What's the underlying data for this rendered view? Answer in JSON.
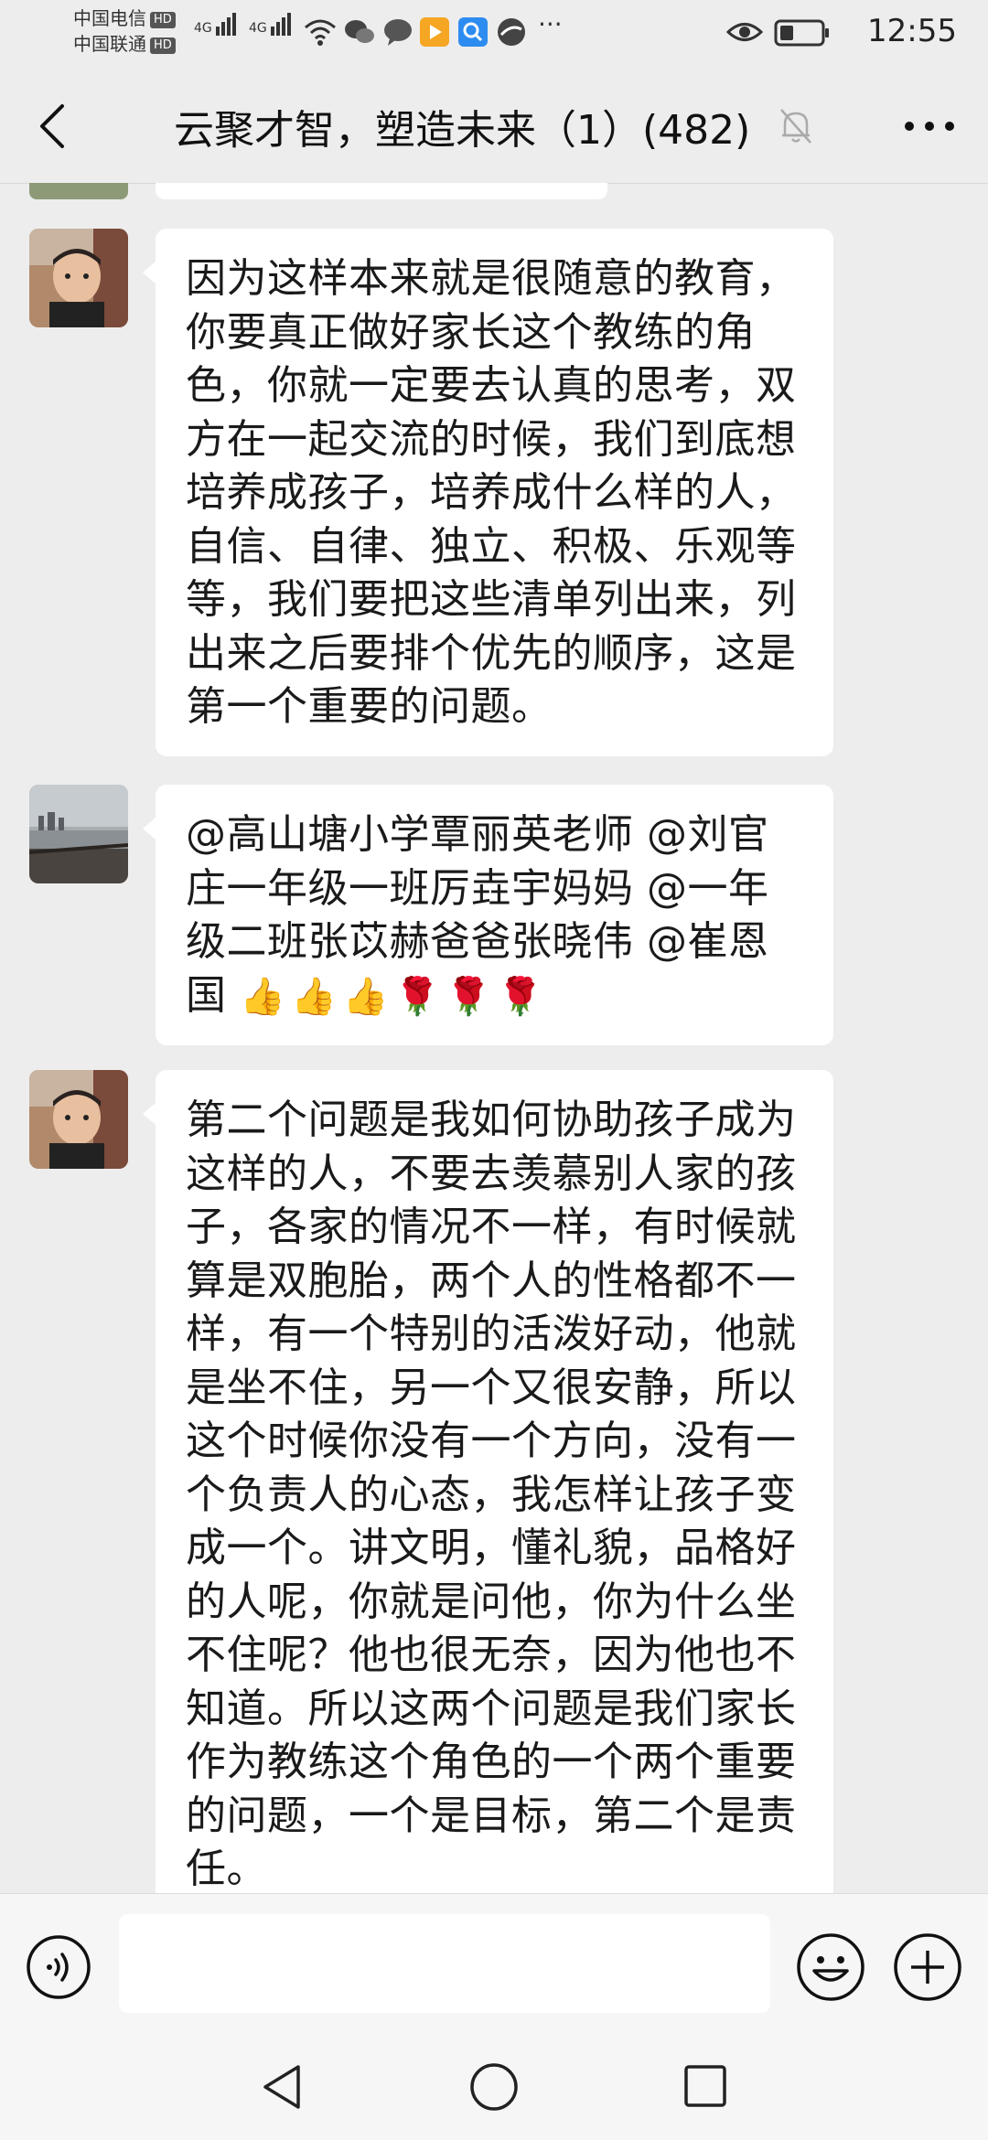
{
  "status_bar": {
    "carrier_1": "中国电信",
    "carrier_2": "中国联通",
    "hd_badge": "HD",
    "network_1": "4G",
    "network_2": "4G",
    "time": "12:55",
    "notification_more": "···"
  },
  "header": {
    "title": "云聚才智，塑造未来（1）(482)",
    "icons": [
      "back-icon",
      "mute-bell-icon",
      "more-icon"
    ]
  },
  "messages": [
    {
      "sender_avatar": "boy-photo",
      "text": "因为这样本来就是很随意的教育，\n你要真正做好家长这个教练的角\n色，你就一定要去认真的思考，双\n方在一起交流的时候，我们到底想\n培养成孩子，培养成什么样的人，\n自信、自律、独立、积极、乐观等\n等，我们要把这些清单列出来，列\n出来之后要排个优先的顺序，这是\n第一个重要的问题。"
    },
    {
      "sender_avatar": "lake-photo",
      "text": "@高山塘小学覃丽英老师 @刘官\n庄一年级一班厉垚宇妈妈 @一年\n级二班张苡赫爸爸张晓伟 @崔恩\n国",
      "emojis": [
        "👍",
        "👍",
        "👍",
        "🌹",
        "🌹",
        "🌹"
      ]
    },
    {
      "sender_avatar": "boy-photo",
      "text": "第二个问题是我如何协助孩子成为\n这样的人，不要去羡慕别人家的孩\n子，各家的情况不一样，有时候就\n算是双胞胎，两个人的性格都不一\n样，有一个特别的活泼好动，他就\n是坐不住，另一个又很安静，所以\n这个时候你没有一个方向，没有一\n个负责人的心态，我怎样让孩子变\n成一个。讲文明，懂礼貌，品格好\n的人呢，你就是问他，你为什么坐\n不住呢？他也很无奈，因为他也不\n知道。所以这两个问题是我们家长\n作为教练这个角色的一个两个重要\n的问题，一个是目标，第二个是责\n任。"
    }
  ],
  "input_bar": {
    "text_value": "",
    "icons": [
      "voice-icon",
      "emoji-icon",
      "plus-icon"
    ]
  },
  "nav_bar": {
    "icons": [
      "nav-back-icon",
      "nav-home-icon",
      "nav-recents-icon"
    ]
  }
}
